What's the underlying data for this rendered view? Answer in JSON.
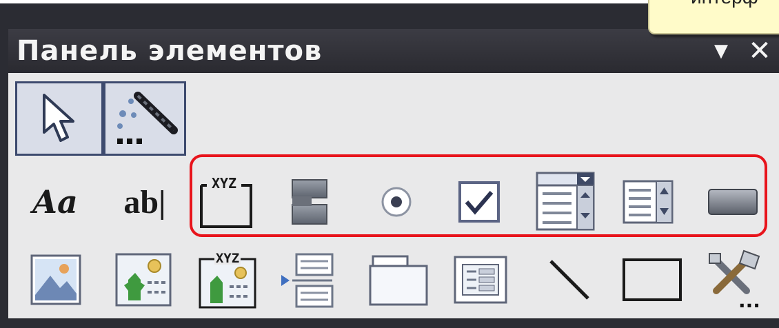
{
  "window": {
    "title": "Панель элементов",
    "options_glyph": "▼",
    "close_glyph": "✕"
  },
  "callout": {
    "text": "интерф"
  },
  "tools": {
    "row1": [
      {
        "name": "select-objects-tool",
        "icon": "pointer-arrow-icon",
        "active": true
      },
      {
        "name": "control-wizards-tool",
        "icon": "magic-wand-icon",
        "active": true
      }
    ],
    "row2": [
      {
        "name": "label-tool",
        "icon": "label-aa-icon",
        "text": "Aa"
      },
      {
        "name": "textbox-tool",
        "icon": "textbox-ab-icon",
        "text": "ab|"
      },
      {
        "name": "option-group-tool",
        "icon": "option-group-icon",
        "text": "XYZ"
      },
      {
        "name": "toggle-button-tool",
        "icon": "toggle-button-icon"
      },
      {
        "name": "option-button-tool",
        "icon": "radio-button-icon"
      },
      {
        "name": "check-box-tool",
        "icon": "check-box-icon"
      },
      {
        "name": "combo-box-tool",
        "icon": "combo-box-icon"
      },
      {
        "name": "list-box-tool",
        "icon": "list-box-icon"
      },
      {
        "name": "command-button-tool",
        "icon": "command-button-icon"
      }
    ],
    "row3": [
      {
        "name": "image-tool",
        "icon": "image-icon"
      },
      {
        "name": "unbound-object-frame-tool",
        "icon": "unbound-object-frame-icon"
      },
      {
        "name": "bound-object-frame-tool",
        "icon": "bound-object-frame-icon",
        "text": "XYZ"
      },
      {
        "name": "page-break-tool",
        "icon": "page-break-icon"
      },
      {
        "name": "tab-control-tool",
        "icon": "tab-control-icon"
      },
      {
        "name": "subform-tool",
        "icon": "subform-icon"
      },
      {
        "name": "line-tool",
        "icon": "line-icon"
      },
      {
        "name": "rectangle-tool",
        "icon": "rectangle-icon"
      },
      {
        "name": "more-controls-tool",
        "icon": "more-controls-icon",
        "text": "..."
      }
    ]
  },
  "highlight_color": "#e8141c"
}
